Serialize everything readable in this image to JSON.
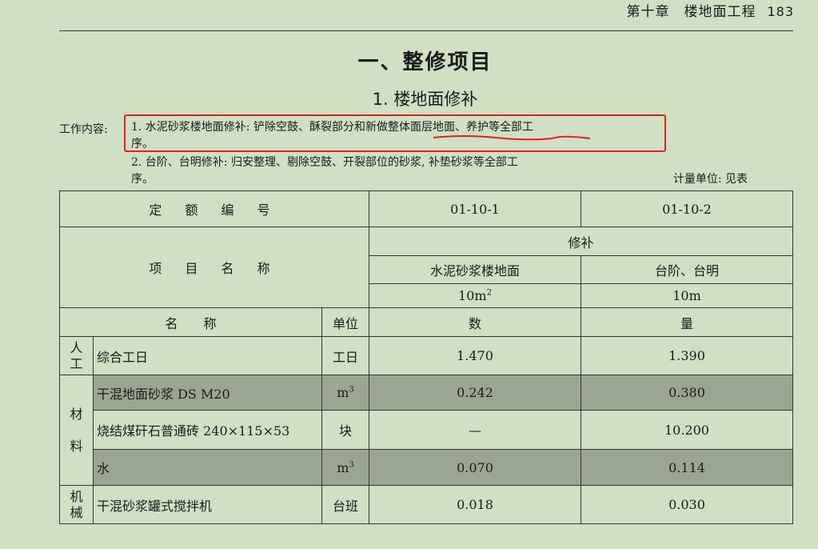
{
  "header": {
    "chapter": "第十章　楼地面工程",
    "page_number": "183"
  },
  "title": "一、整修项目",
  "subtitle": "1. 楼地面修补",
  "work_content": {
    "label": "工作内容:",
    "item1_line1": "1. 水泥砂浆楼地面修补: 铲除空鼓、酥裂部分和新做整体面层地面、养护等全部工",
    "item1_line2": "序。",
    "item2_line1": "2. 台阶、台明修补: 归安整理、剔除空鼓、开裂部位的砂浆, 补垫砂浆等全部工",
    "item2_line2": "序。"
  },
  "unit_note": "计量单位: 见表",
  "table": {
    "quota_number_label": "定 额 编 号",
    "codes": [
      "01-10-1",
      "01-10-2"
    ],
    "item_name_label": "项 目 名 称",
    "group_label": "修补",
    "item_names": [
      "水泥砂浆楼地面",
      "台阶、台明"
    ],
    "unit_base": "10m",
    "unit_sup": "2",
    "unit2": "10m",
    "col_name": "名　　称",
    "col_unit": "单位",
    "col_qty1": "数",
    "col_qty2": "量",
    "rows": [
      {
        "category": "人工",
        "cat_line1": "人",
        "cat_line2": "工",
        "name": "综合工日",
        "unit": "工日",
        "unit_sup": "",
        "v1": "1.470",
        "v2": "1.390"
      },
      {
        "category": "材料",
        "name": "干混地面砂浆 DS M20",
        "unit": "m",
        "unit_sup": "3",
        "v1": "0.242",
        "v2": "0.380"
      },
      {
        "name": "烧结煤矸石普通砖 240×115×53",
        "unit": "块",
        "unit_sup": "",
        "v1": "—",
        "v2": "10.200"
      },
      {
        "name": "水",
        "unit": "m",
        "unit_sup": "3",
        "v1": "0.070",
        "v2": "0.114"
      },
      {
        "category": "机械",
        "cat_line1": "机",
        "cat_line2": "械",
        "name": "干混砂浆罐式搅拌机",
        "unit": "台班",
        "unit_sup": "",
        "v1": "0.018",
        "v2": "0.030"
      }
    ],
    "material_cat": {
      "line1": "材",
      "line2": "料"
    }
  },
  "annotation_color": "#e02020"
}
